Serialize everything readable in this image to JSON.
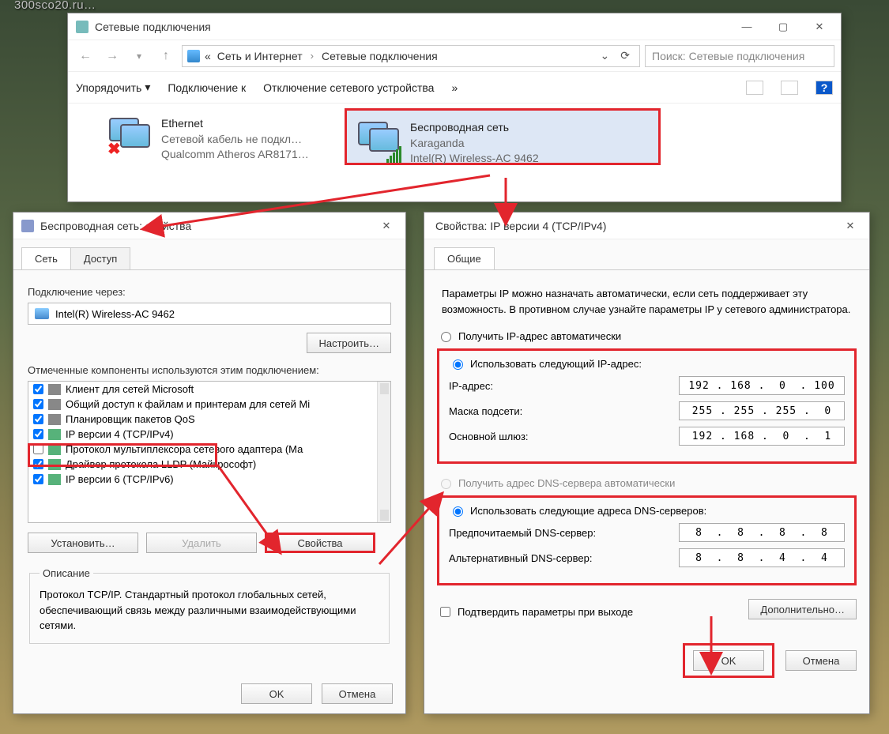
{
  "watermark": "300sco20.ru…",
  "explorer": {
    "title": "Сетевые подключения",
    "breadcrumb_pre": "«",
    "breadcrumb1": "Сеть и Интернет",
    "breadcrumb2": "Сетевые подключения",
    "refresh": "⟳",
    "search_placeholder": "Поиск: Сетевые подключения",
    "toolbar": {
      "organize": "Упорядочить",
      "connect": "Подключение к",
      "disable": "Отключение сетевого устройства",
      "more": "»",
      "help": "?"
    },
    "ethernet": {
      "name": "Ethernet",
      "status": "Сетевой кабель не подкл…",
      "hw": "Qualcomm Atheros AR8171…"
    },
    "wireless": {
      "name": "Беспроводная сеть",
      "net": "Karaganda",
      "hw": "Intel(R) Wireless-AC 9462"
    }
  },
  "props": {
    "title": "Беспроводная сеть: свойства",
    "tab_net": "Сеть",
    "tab_access": "Доступ",
    "connect_via": "Подключение через:",
    "adapter": "Intel(R) Wireless-AC 9462",
    "configure": "Настроить…",
    "components_label": "Отмеченные компоненты используются этим подключением:",
    "components": [
      "Клиент для сетей Microsoft",
      "Общий доступ к файлам и принтерам для сетей Mi",
      "Планировщик пакетов QoS",
      "IP версии 4 (TCP/IPv4)",
      "Протокол мультиплексора сетевого адаптера (Ма",
      "Драйвер протокола LLDP (Майкрософт)",
      "IP версии 6 (TCP/IPv6)"
    ],
    "install": "Установить…",
    "remove": "Удалить",
    "properties": "Свойства",
    "desc_title": "Описание",
    "desc_text": "Протокол TCP/IP. Стандартный протокол глобальных сетей, обеспечивающий связь между различными взаимодействующими сетями.",
    "ok": "OK",
    "cancel": "Отмена"
  },
  "ipv4": {
    "title": "Свойства: IP версии 4 (TCP/IPv4)",
    "tab_general": "Общие",
    "intro": "Параметры IP можно назначать автоматически, если сеть поддерживает эту возможность. В противном случае узнайте параметры IP у сетевого администратора.",
    "radio_auto_ip": "Получить IP-адрес автоматически",
    "radio_man_ip": "Использовать следующий IP-адрес:",
    "ip_label": "IP-адрес:",
    "ip_val": "192 . 168 .  0  . 100",
    "mask_label": "Маска подсети:",
    "mask_val": "255 . 255 . 255 .  0",
    "gw_label": "Основной шлюз:",
    "gw_val": "192 . 168 .  0  .  1",
    "radio_auto_dns": "Получить адрес DNS-сервера автоматически",
    "radio_man_dns": "Использовать следующие адреса DNS-серверов:",
    "dns1_label": "Предпочитаемый DNS-сервер:",
    "dns1_val": "8  .  8  .  8  .  8",
    "dns2_label": "Альтернативный DNS-сервер:",
    "dns2_val": "8  .  8  .  4  .  4",
    "confirm_exit": "Подтвердить параметры при выходе",
    "advanced": "Дополнительно…",
    "ok": "OK",
    "cancel": "Отмена"
  }
}
